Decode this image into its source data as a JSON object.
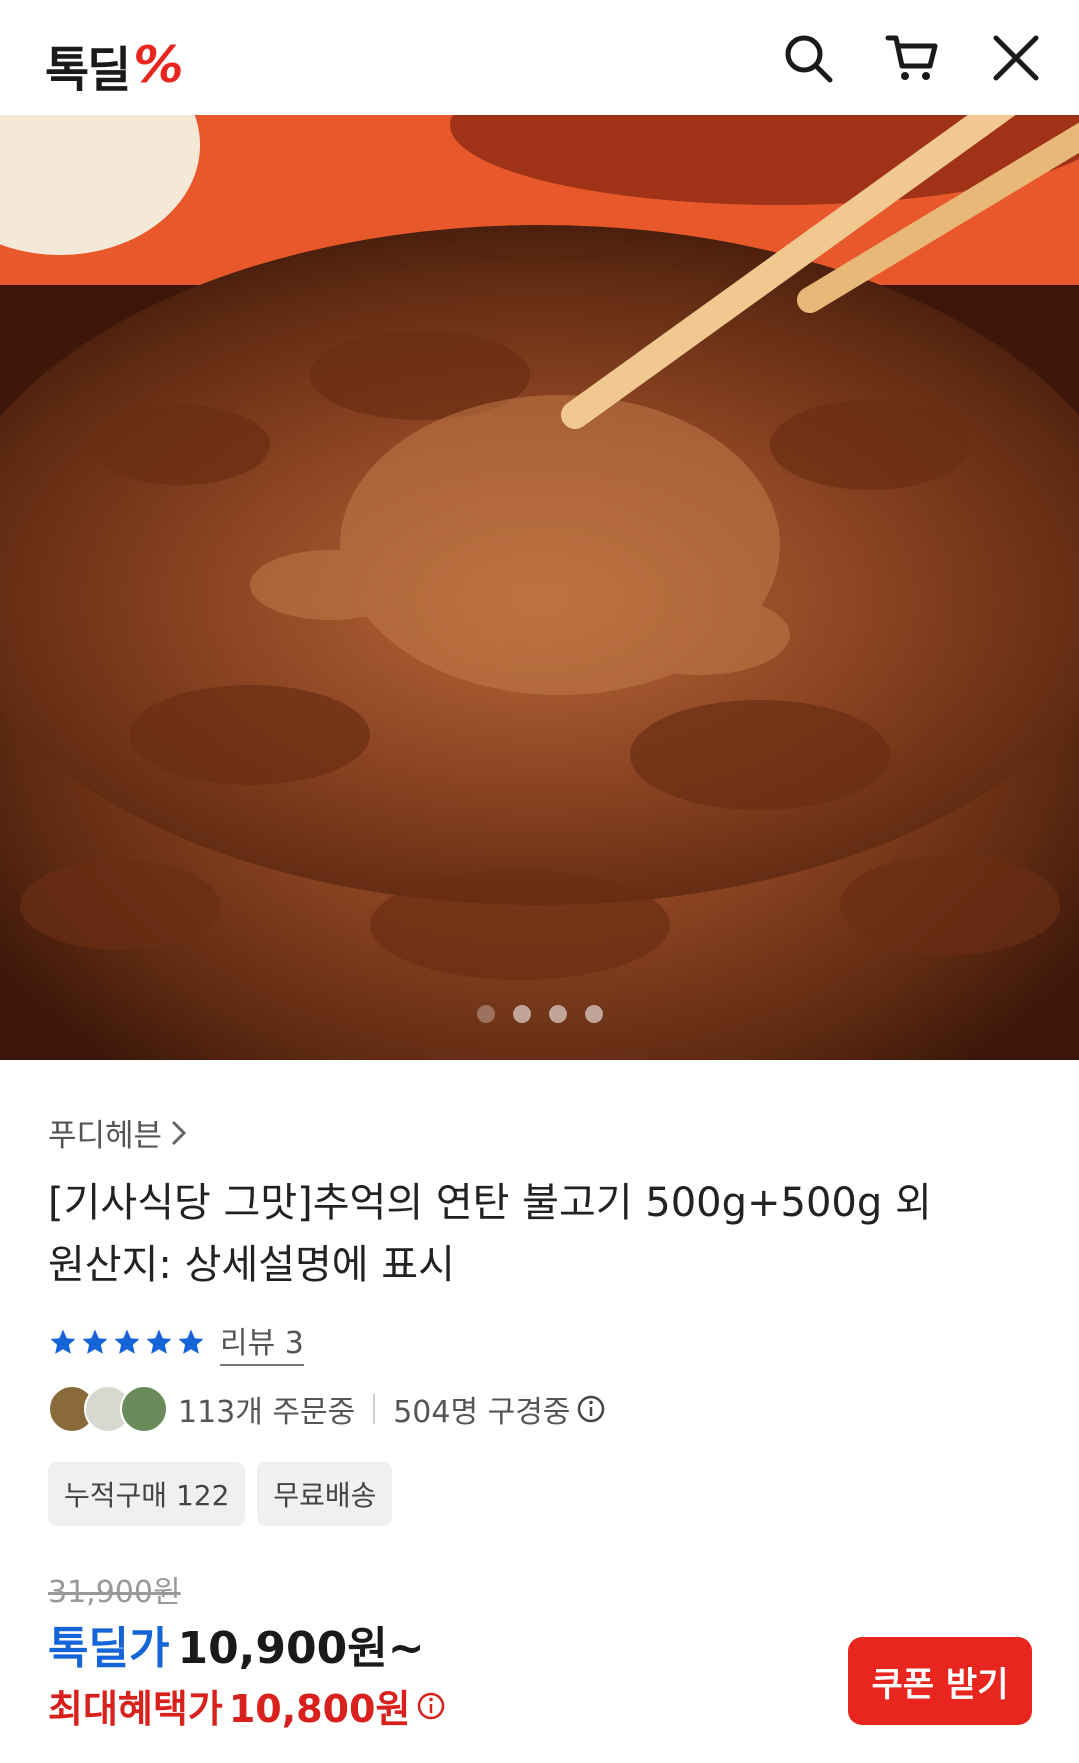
{
  "header": {
    "logo_text": "톡딜",
    "logo_mark": "%",
    "icons": [
      "search-icon",
      "cart-icon",
      "close-icon"
    ]
  },
  "gallery": {
    "image_count": 4,
    "active_index": 0
  },
  "product": {
    "brand": "푸디헤븐",
    "title_line1": "[기사식당 그맛]추억의 연탄 불고기 500g+500g 외",
    "title_line2": "원산지: 상세설명에 표시",
    "rating_stars": 5,
    "review_label": "리뷰 3",
    "orders_text": "113개 주문중",
    "watchers_text": "504명 구경중",
    "tags": [
      "누적구매 122",
      "무료배송"
    ],
    "original_price": "31,900원",
    "deal_label": "톡딜가",
    "deal_price": "10,900원~",
    "max_benefit_label": "최대혜택가",
    "max_benefit_price": "10,800원",
    "coupon_button": "쿠폰 받기"
  },
  "colors": {
    "brand_red": "#e8261f",
    "deal_blue": "#1565d8",
    "star_blue": "#1565d8"
  }
}
